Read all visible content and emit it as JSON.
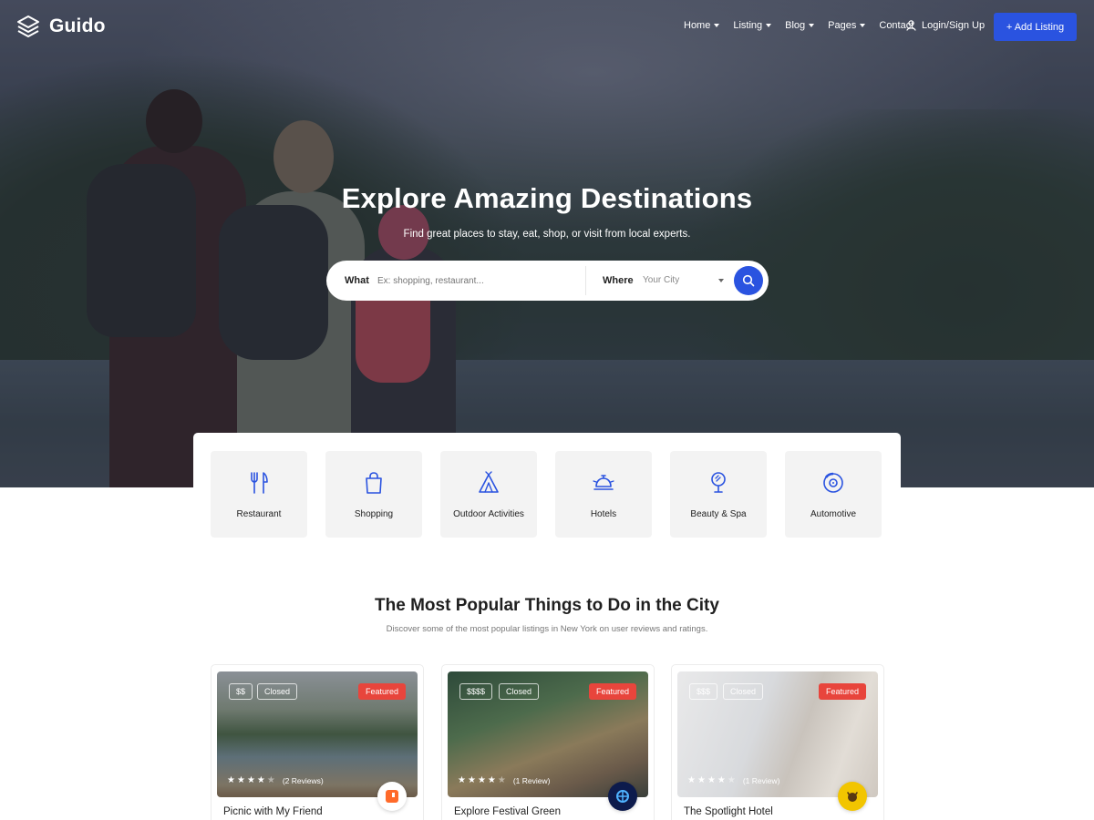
{
  "brand": {
    "name": "Guido"
  },
  "nav": {
    "items": [
      {
        "label": "Home",
        "has_dropdown": true
      },
      {
        "label": "Listing",
        "has_dropdown": true
      },
      {
        "label": "Blog",
        "has_dropdown": true
      },
      {
        "label": "Pages",
        "has_dropdown": true
      },
      {
        "label": "Contact",
        "has_dropdown": false
      }
    ],
    "login_label": "Login/Sign Up",
    "add_listing_label": "+ Add Listing"
  },
  "hero": {
    "title": "Explore Amazing Destinations",
    "subtitle": "Find great places to stay, eat, shop, or visit from local experts."
  },
  "search": {
    "what_label": "What",
    "what_placeholder": "Ex: shopping, restaurant...",
    "where_label": "Where",
    "where_value": "Your City"
  },
  "categories": [
    {
      "label": "Restaurant",
      "icon": "fork-knife-icon"
    },
    {
      "label": "Shopping",
      "icon": "shopping-bag-icon"
    },
    {
      "label": "Outdoor Activities",
      "icon": "tent-icon"
    },
    {
      "label": "Hotels",
      "icon": "hotel-bell-icon"
    },
    {
      "label": "Beauty & Spa",
      "icon": "mirror-icon"
    },
    {
      "label": "Automotive",
      "icon": "disc-brake-icon"
    }
  ],
  "section": {
    "title": "The Most Popular Things to Do in the City",
    "subtitle": "Discover some of the most popular listings in New York on user reviews and ratings."
  },
  "listings": [
    {
      "name": "Picnic with My Friend",
      "price": "$$",
      "status": "Closed",
      "featured_label": "Featured",
      "rating": 3.5,
      "reviews": "(2 Reviews)",
      "badge_color": "#ff6a2a"
    },
    {
      "name": "Explore Festival Green",
      "price": "$$$$",
      "status": "Closed",
      "featured_label": "Featured",
      "rating": 4,
      "reviews": "(1 Review)",
      "badge_color": "#0d1b4c"
    },
    {
      "name": "The Spotlight Hotel",
      "price": "$$$",
      "status": "Closed",
      "featured_label": "Featured",
      "rating": 4,
      "reviews": "(1 Review)",
      "badge_color": "#f2c500"
    }
  ],
  "colors": {
    "accent": "#2a53e0",
    "featured": "#e8453c"
  }
}
